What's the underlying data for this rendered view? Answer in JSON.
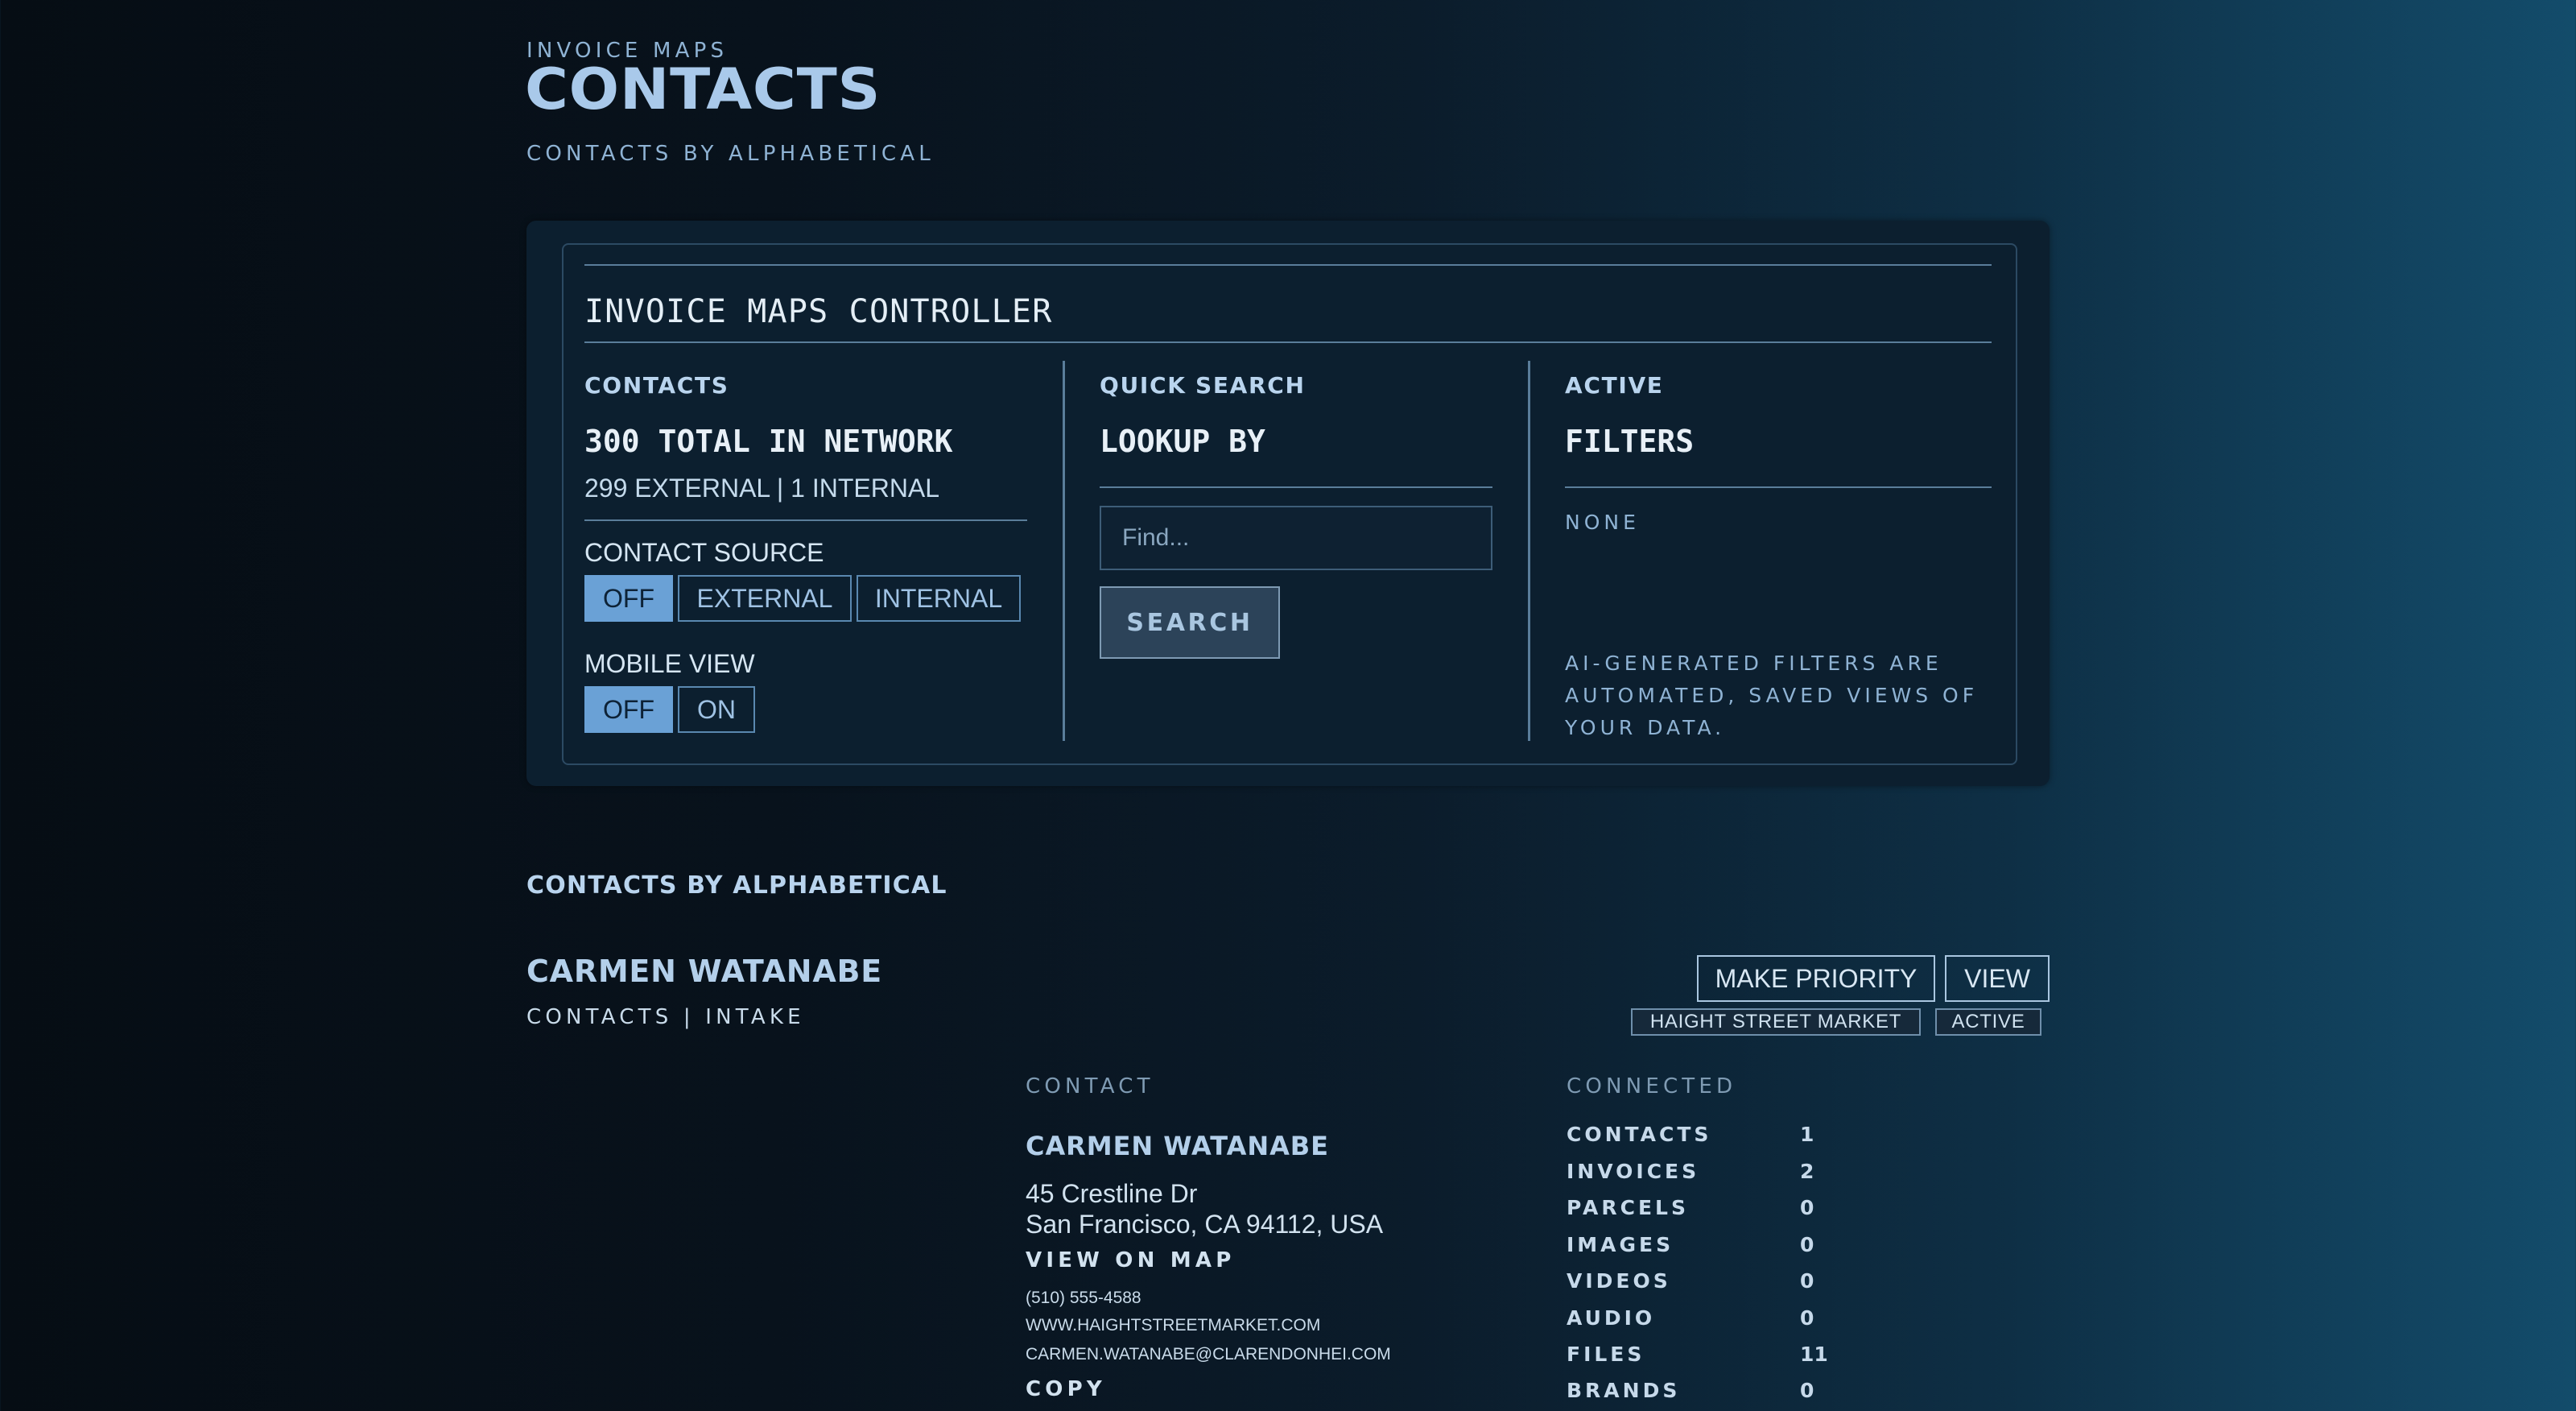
{
  "header": {
    "eyebrow": "INVOICE MAPS",
    "title": "CONTACTS",
    "subtitle": "CONTACTS BY ALPHABETICAL"
  },
  "controller": {
    "title": "INVOICE MAPS CONTROLLER",
    "contacts": {
      "heading": "CONTACTS",
      "total": "300 TOTAL IN NETWORK",
      "breakdown": "299 EXTERNAL | 1 INTERNAL",
      "source_label": "CONTACT SOURCE",
      "source_options": [
        "OFF",
        "EXTERNAL",
        "INTERNAL"
      ],
      "source_selected": "OFF",
      "mobile_label": "MOBILE VIEW",
      "mobile_options": [
        "OFF",
        "ON"
      ],
      "mobile_selected": "OFF"
    },
    "quick_search": {
      "heading": "QUICK SEARCH",
      "lookup": "LOOKUP BY",
      "placeholder": "Find...",
      "button": "SEARCH"
    },
    "active": {
      "heading": "ACTIVE",
      "filters": "FILTERS",
      "none": "NONE",
      "note": "AI-GENERATED FILTERS ARE AUTOMATED, SAVED VIEWS OF YOUR DATA."
    }
  },
  "list": {
    "heading": "CONTACTS BY ALPHABETICAL",
    "contact": {
      "name": "CARMEN WATANABE",
      "meta": "CONTACTS | INTAKE",
      "actions": {
        "priority": "MAKE PRIORITY",
        "view": "VIEW"
      },
      "tags": [
        "HAIGHT STREET MARKET",
        "ACTIVE"
      ],
      "contact_section": {
        "label": "CONTACT",
        "name": "CARMEN WATANABE",
        "address_line1": "45 Crestline Dr",
        "address_line2": "San Francisco, CA 94112, USA",
        "map_link": "VIEW ON MAP",
        "phone": "(510) 555-4588",
        "website": "WWW.HAIGHTSTREETMARKET.COM",
        "email": "CARMEN.WATANABE@CLARENDONHEI.COM",
        "cut_off_label": "COPY"
      },
      "connected": {
        "label": "CONNECTED",
        "items": [
          {
            "label": "CONTACTS",
            "value": "1"
          },
          {
            "label": "INVOICES",
            "value": "2"
          },
          {
            "label": "PARCELS",
            "value": "0"
          },
          {
            "label": "IMAGES",
            "value": "0"
          },
          {
            "label": "VIDEOS",
            "value": "0"
          },
          {
            "label": "AUDIO",
            "value": "0"
          },
          {
            "label": "FILES",
            "value": "11"
          },
          {
            "label": "BRANDS",
            "value": "0"
          }
        ]
      }
    }
  },
  "colors": {
    "accent": "#6aa1d6",
    "heading": "#a9c9ea",
    "panel": "#0c1f2f"
  }
}
